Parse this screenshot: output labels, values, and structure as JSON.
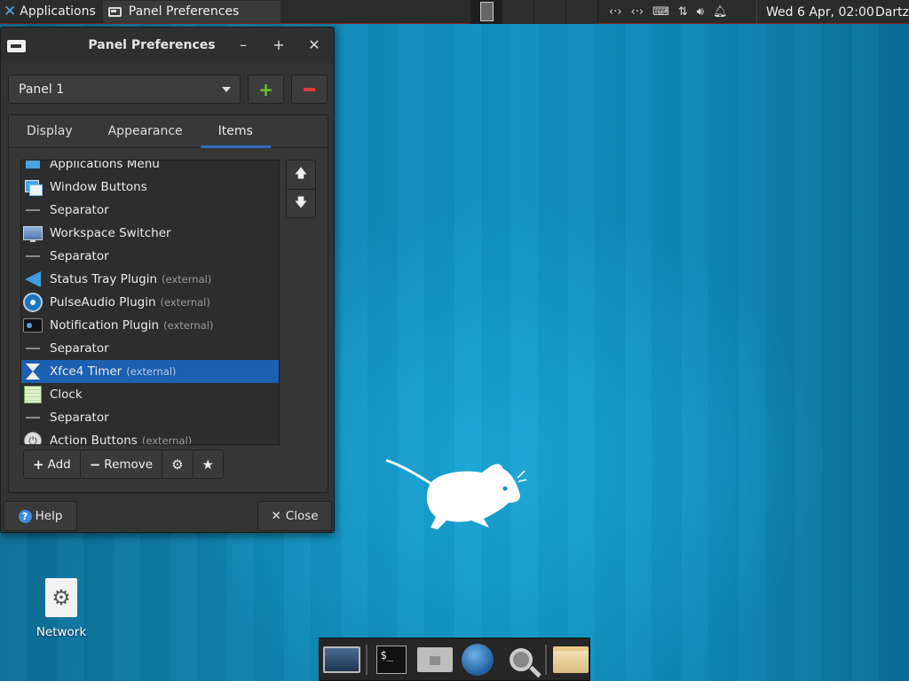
{
  "top_panel": {
    "applications_label": "Applications",
    "task_title": "Panel Preferences",
    "clock": "Wed  6 Apr, 02:00",
    "user": "Dartz"
  },
  "dialog": {
    "title": "Panel Preferences",
    "panel_select": "Panel 1",
    "tabs": [
      "Display",
      "Appearance",
      "Items"
    ],
    "active_tab": "Items",
    "items": [
      {
        "label": "Applications Menu",
        "icon": "applications-menu-icon",
        "external": ""
      },
      {
        "label": "Window Buttons",
        "icon": "window-buttons-icon",
        "external": ""
      },
      {
        "label": "Separator",
        "icon": "separator-icon",
        "external": ""
      },
      {
        "label": "Workspace Switcher",
        "icon": "workspace-switcher-icon",
        "external": ""
      },
      {
        "label": "Separator",
        "icon": "separator-icon",
        "external": ""
      },
      {
        "label": "Status Tray Plugin",
        "icon": "status-tray-icon",
        "external": "(external)"
      },
      {
        "label": "PulseAudio Plugin",
        "icon": "pulseaudio-icon",
        "external": "(external)"
      },
      {
        "label": "Notification Plugin",
        "icon": "notification-icon",
        "external": "(external)"
      },
      {
        "label": "Separator",
        "icon": "separator-icon",
        "external": ""
      },
      {
        "label": "Xfce4 Timer",
        "icon": "hourglass-icon",
        "external": "(external)"
      },
      {
        "label": "Clock",
        "icon": "clock-icon",
        "external": ""
      },
      {
        "label": "Separator",
        "icon": "separator-icon",
        "external": ""
      },
      {
        "label": "Action Buttons",
        "icon": "power-icon",
        "external": "(external)"
      }
    ],
    "selected_item": "Xfce4 Timer",
    "add_label": "Add",
    "remove_label": "Remove",
    "help_label": "Help",
    "close_label": "Close"
  },
  "desktop": {
    "icon_label": "Network"
  },
  "colors": {
    "selection": "#1d5fb0",
    "tab_underline": "#2f6dbf",
    "add_green": "#6fc12b",
    "remove_red": "#e03a3a"
  }
}
